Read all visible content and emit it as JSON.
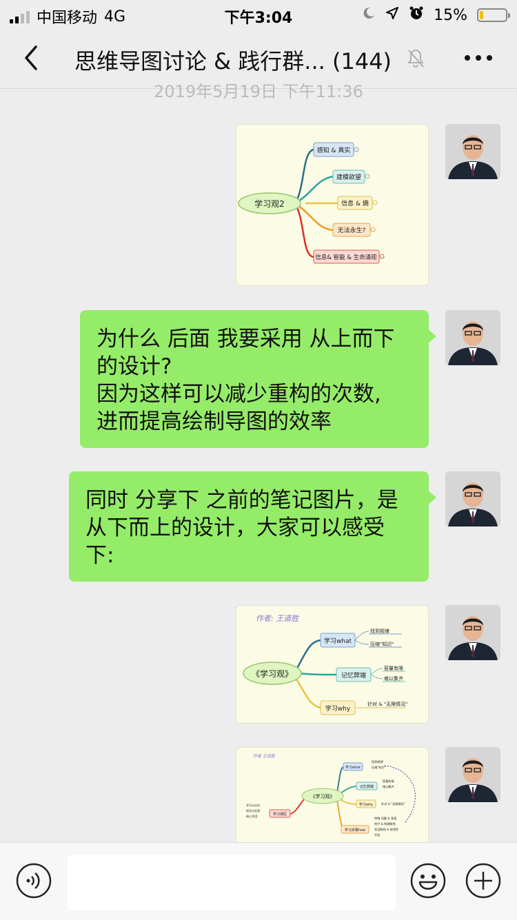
{
  "status_bar": {
    "carrier": "中国移动",
    "network": "4G",
    "time": "下午3:04",
    "battery": "15%",
    "battery_level": 0.15
  },
  "header": {
    "title": "思维导图讨论 & 践行群... (144)"
  },
  "messages": {
    "timestamp": "2019年5月19日 下午11:36",
    "image1": {
      "center": "学习观2",
      "branches": [
        "感知 & 真实",
        "建模欲望",
        "信息 & 熵",
        "无法永生?",
        "信息& 智能 & 生命涌现"
      ]
    },
    "text1": {
      "lines": [
        "为什么 后面 我要采用 从上而下",
        "的设计?",
        "因为这样可以减少重构的次数,",
        "进而提高绘制导图的效率"
      ]
    },
    "text2": {
      "lines": [
        "同时 分享下 之前的笔记图片，是",
        "从下而上的设计，大家可以感受",
        "下:"
      ]
    },
    "image2": {
      "author": "作者: 王道胜",
      "center": "《学习观》",
      "branches": [
        "学习what",
        "记忆弊端",
        "学习why"
      ],
      "leaves": [
        "找到规律",
        "压缩\"知识\"",
        "容量有限",
        "难以集齐",
        "针对 & \"无限情况\""
      ]
    },
    "image3": {
      "author": "作者 王道胜",
      "center": "《学习观》",
      "branches": [
        "学习what",
        "记忆弊端",
        "学习why",
        "学习误区",
        "学习步骤how"
      ],
      "left_leaves": [
        "学习≠记忆",
        "知识≠信息",
        "核心学会"
      ],
      "right_leaves": [
        "找到规律",
        "压缩\"知识\"",
        "容量有限",
        "难以集齐",
        "针对 & \"无限情况\"",
        "特殊 问题 & 答案",
        "例子 & 构建联系",
        "验证联结 & 校验性",
        "学会"
      ]
    }
  },
  "input_bar": {
    "placeholder": ""
  },
  "colors": {
    "bubble": "#95ec69",
    "background": "#ededed"
  }
}
